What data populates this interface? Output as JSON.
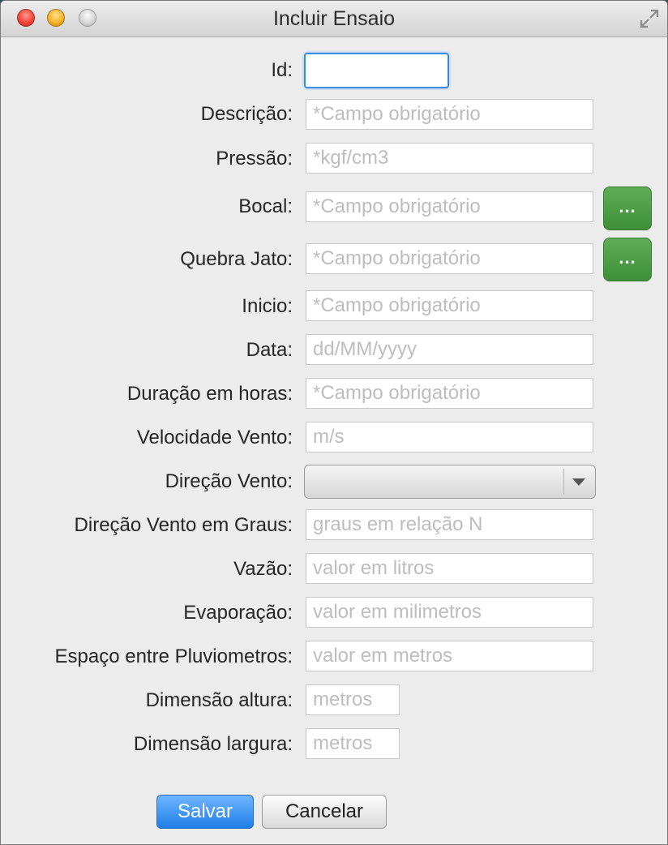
{
  "window": {
    "title": "Incluir Ensaio"
  },
  "form": {
    "id": {
      "label": "Id:",
      "value": "",
      "placeholder": ""
    },
    "descricao": {
      "label": "Descrição:",
      "placeholder": "*Campo obrigatório"
    },
    "pressao": {
      "label": "Pressão:",
      "placeholder": "*kgf/cm3"
    },
    "bocal": {
      "label": "Bocal:",
      "placeholder": "*Campo obrigatório",
      "button": "..."
    },
    "quebra_jato": {
      "label": "Quebra Jato:",
      "placeholder": "*Campo obrigatório",
      "button": "..."
    },
    "inicio": {
      "label": "Inicio:",
      "placeholder": "*Campo obrigatório"
    },
    "data": {
      "label": "Data:",
      "placeholder": "dd/MM/yyyy"
    },
    "duracao": {
      "label": "Duração em horas:",
      "placeholder": "*Campo obrigatório"
    },
    "velocidade_vento": {
      "label": "Velocidade Vento:",
      "placeholder": "m/s"
    },
    "direcao_vento": {
      "label": "Direção Vento:",
      "selected": ""
    },
    "direcao_vento_graus": {
      "label": "Direção Vento em Graus:",
      "placeholder": "graus em relação N"
    },
    "vazao": {
      "label": "Vazão:",
      "placeholder": "valor em litros"
    },
    "evaporacao": {
      "label": "Evaporação:",
      "placeholder": "valor em milimetros"
    },
    "espaco_pluviometros": {
      "label": "Espaço entre Pluviometros:",
      "placeholder": "valor em metros"
    },
    "dimensao_altura": {
      "label": "Dimensão altura:",
      "placeholder": "metros"
    },
    "dimensao_largura": {
      "label": "Dimensão largura:",
      "placeholder": "metros"
    }
  },
  "actions": {
    "save_label": "Salvar",
    "cancel_label": "Cancelar"
  },
  "colors": {
    "accent_green": "#4a9a42",
    "focus_blue": "#3b8de0",
    "primary_button": "#1f7ee8"
  },
  "icons": {
    "close": "close-icon",
    "minimize": "minimize-icon",
    "zoom": "zoom-icon",
    "fullscreen": "fullscreen-icon",
    "dropdown": "chevron-down-icon"
  }
}
